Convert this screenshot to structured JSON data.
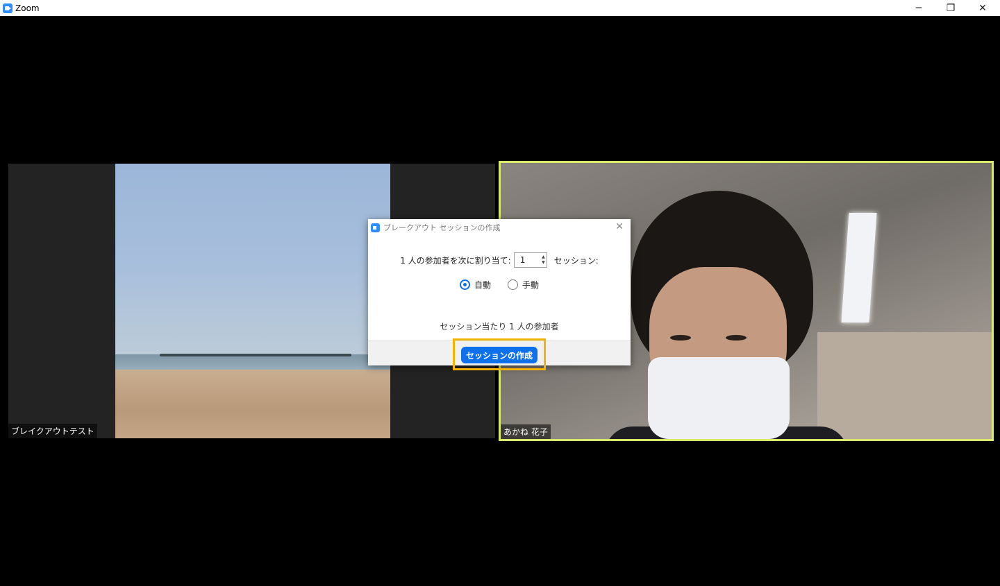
{
  "window": {
    "app_title": "Zoom",
    "minimize": "─",
    "maximize": "❐",
    "close": "✕"
  },
  "tiles": {
    "left": {
      "name_label": "ブレイクアウトテスト"
    },
    "right": {
      "name_label": "あかね 花子",
      "active_speaker_border_color": "#d9e96b"
    }
  },
  "dialog": {
    "title": "ブレークアウト セッションの作成",
    "close": "✕",
    "assign_prefix": "1 人の参加者を次に割り当て:",
    "session_count": "1",
    "assign_suffix": "セッション:",
    "radio_auto": "自動",
    "radio_manual": "手動",
    "selected_mode": "自動",
    "per_session_text": "セッション当たり 1 人の参加者",
    "create_button": "セッションの作成"
  },
  "colors": {
    "accent": "#0e71eb",
    "highlight": "#f5b400"
  }
}
